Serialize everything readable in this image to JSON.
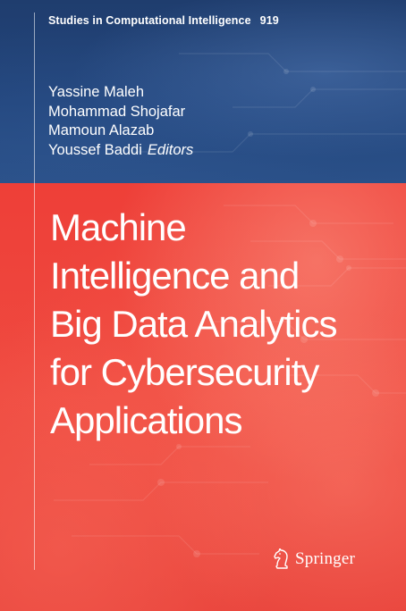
{
  "series": {
    "name": "Studies in Computational Intelligence",
    "volume": "919"
  },
  "editors": {
    "names": [
      "Yassine Maleh",
      "Mohammad Shojafar",
      "Mamoun Alazab",
      "Youssef Baddi"
    ],
    "role": "Editors"
  },
  "title": {
    "lines": [
      "Machine",
      "Intelligence and",
      "Big Data Analytics",
      "for Cybersecurity",
      "Applications"
    ]
  },
  "publisher": {
    "name": "Springer",
    "logo_icon": "chess-knight-icon"
  },
  "colors": {
    "top_band": "#23467d",
    "main_background": "#ee4a40",
    "text": "#ffffff"
  }
}
